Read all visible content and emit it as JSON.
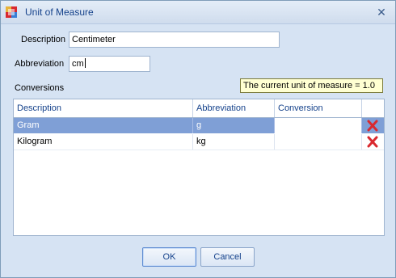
{
  "window": {
    "title": "Unit of Measure",
    "app_icon": "app-icon",
    "close_icon": "close-icon"
  },
  "form": {
    "description_label": "Description",
    "description_value": "Centimeter",
    "abbreviation_label": "Abbreviation",
    "abbreviation_value": "cm",
    "conversions_label": "Conversions"
  },
  "tooltip": "The current unit of measure = 1.0",
  "grid": {
    "columns": [
      "Description",
      "Abbreviation",
      "Conversion"
    ],
    "rows": [
      {
        "description": "Gram",
        "abbreviation": "g",
        "conversion": "",
        "selected": true,
        "delete_icon": "delete-icon"
      },
      {
        "description": "Kilogram",
        "abbreviation": "kg",
        "conversion": "",
        "selected": false,
        "delete_icon": "delete-icon"
      }
    ]
  },
  "buttons": {
    "ok": "OK",
    "cancel": "Cancel"
  },
  "colors": {
    "accent": "#15428b",
    "selection": "#7f9fd6",
    "delete": "#d9292f",
    "tooltip_bg": "#ffffd2"
  }
}
